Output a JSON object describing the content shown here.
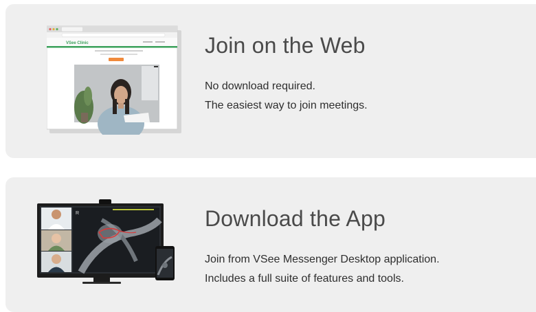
{
  "web": {
    "title": "Join on the Web",
    "line1": "No download required.",
    "line2": "The easiest way to join meetings.",
    "thumb_brand": "VSee Clinic"
  },
  "app": {
    "title": "Download the App",
    "line1": "Join from VSee Messenger Desktop application.",
    "line2": "Includes a full suite of features and tools.",
    "monitor_label": "R"
  },
  "colors": {
    "card_bg": "#efefef",
    "title": "#4a4a4a",
    "text": "#2e2e2e",
    "brand_green": "#3aa05a",
    "accent_orange": "#f08a3c"
  }
}
